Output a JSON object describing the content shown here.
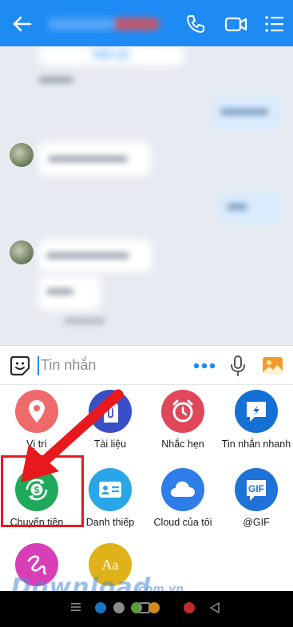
{
  "header": {
    "title": "",
    "back_icon": "arrow-left-icon",
    "call_icon": "phone-icon",
    "video_icon": "video-camera-icon",
    "menu_icon": "list-menu-icon",
    "color": "#1e8bf5"
  },
  "chat": {
    "call_back_label": "GỌI LẠI"
  },
  "input": {
    "placeholder": "Tin nhắn",
    "sticker_icon": "sticker-icon",
    "more_icon": "more-dots-icon",
    "mic_icon": "microphone-icon",
    "gallery_icon": "image-gallery-icon"
  },
  "actions": [
    {
      "label": "Vị trí",
      "icon": "location-pin-icon",
      "color": "#ef6b6b"
    },
    {
      "label": "Tài liệu",
      "icon": "document-icon",
      "color": "#3a4ec7"
    },
    {
      "label": "Nhắc hẹn",
      "icon": "alarm-clock-icon",
      "color": "#e0485a"
    },
    {
      "label": "Tin nhắn nhanh",
      "icon": "quick-message-icon",
      "color": "#1570d6"
    },
    {
      "label": "Chuyển tiền",
      "icon": "money-transfer-icon",
      "color": "#1fa95a"
    },
    {
      "label": "Danh thiếp",
      "icon": "business-card-icon",
      "color": "#29a6e8"
    },
    {
      "label": "Cloud của tôi",
      "icon": "cloud-icon",
      "color": "#2e7de8"
    },
    {
      "label": "@GIF",
      "icon": "gif-icon",
      "color": "#1f73d8"
    },
    {
      "label": "",
      "icon": "doodle-icon",
      "color": "#d83fb7"
    },
    {
      "label": "",
      "icon": "font-style-icon",
      "color": "#e0b21a"
    }
  ],
  "watermark": {
    "text": "Download",
    "suffix": ".com.vn"
  },
  "navbar": {
    "dots": [
      "#1a74c0",
      "#8a8a8a",
      "#5a9e3a",
      "#d08a1a",
      "#c02a2a"
    ]
  }
}
